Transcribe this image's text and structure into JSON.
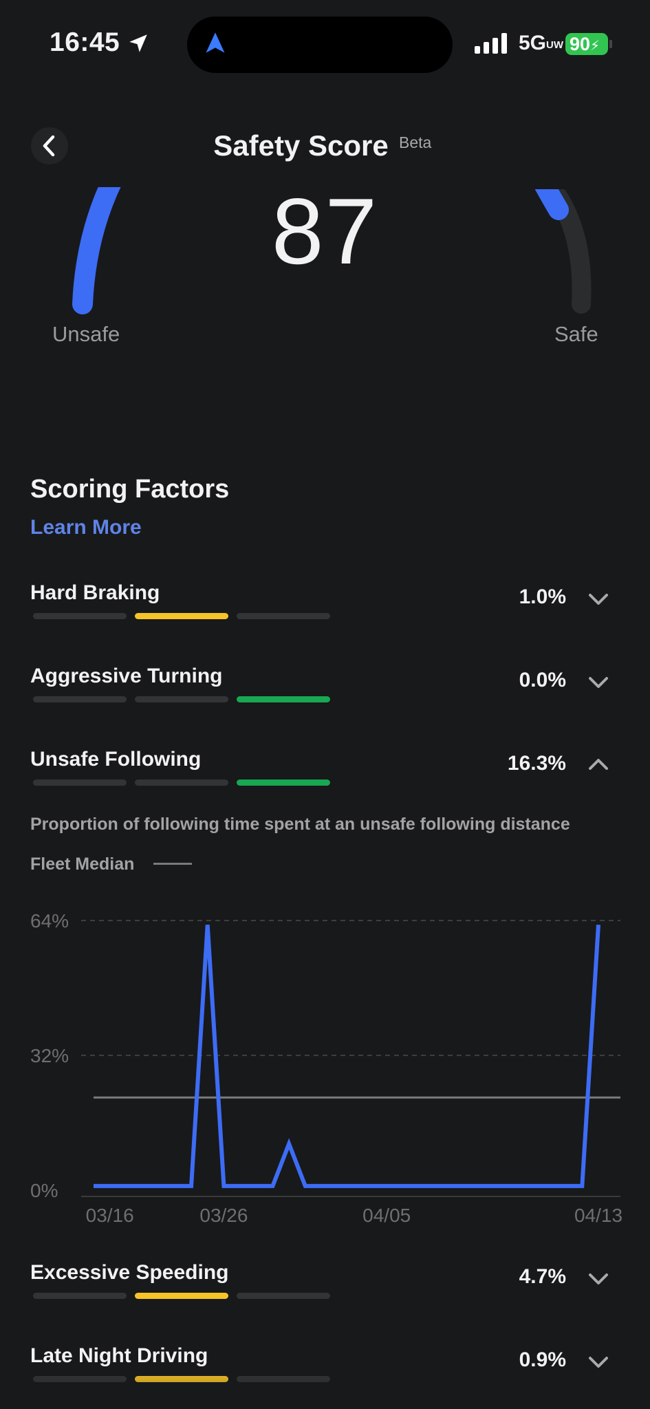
{
  "status_bar": {
    "time": "16:45",
    "network": "5G",
    "network_super": "UW",
    "battery": "90",
    "signal_bars": 4
  },
  "header": {
    "title": "Safety Score",
    "badge": "Beta"
  },
  "gauge": {
    "score": "87",
    "left_label": "Unsafe",
    "right_label": "Safe",
    "accent": "#3d6cf5"
  },
  "factors_section": {
    "title": "Scoring Factors",
    "learn_more": "Learn More"
  },
  "factors": [
    {
      "name": "Hard Braking",
      "value": "1.0%",
      "active_segment": 2,
      "segment_color": "#f7c328",
      "expanded": false
    },
    {
      "name": "Aggressive Turning",
      "value": "0.0%",
      "active_segment": 3,
      "segment_color": "#18a752",
      "expanded": false
    },
    {
      "name": "Unsafe Following",
      "value": "16.3%",
      "active_segment": 3,
      "segment_color": "#18a752",
      "expanded": true
    },
    {
      "name": "Excessive Speeding",
      "value": "4.7%",
      "active_segment": 2,
      "segment_color": "#f7c328",
      "expanded": false
    },
    {
      "name": "Late Night Driving",
      "value": "0.9%",
      "active_segment": 2,
      "segment_color": "#f7c328",
      "expanded": false
    }
  ],
  "detail": {
    "description": "Proportion of following time spent at an unsafe following distance",
    "legend": "Fleet Median"
  },
  "chart_data": {
    "type": "line",
    "y_ticks": [
      "64%",
      "32%",
      "0%"
    ],
    "x_ticks": [
      "03/16",
      "03/26",
      "04/05",
      "04/13"
    ],
    "ylim": [
      0,
      64
    ],
    "fleet_median": 22,
    "line_color": "#3d6cf5",
    "median_color": "#7a7a7a",
    "series": [
      {
        "values": [
          1,
          1,
          1,
          1,
          1,
          1,
          1,
          63,
          1,
          1,
          1,
          1,
          11,
          1,
          1,
          1,
          1,
          1,
          1,
          1,
          1,
          1,
          1,
          1,
          1,
          1,
          1,
          1,
          1,
          1,
          1,
          63
        ]
      }
    ]
  }
}
